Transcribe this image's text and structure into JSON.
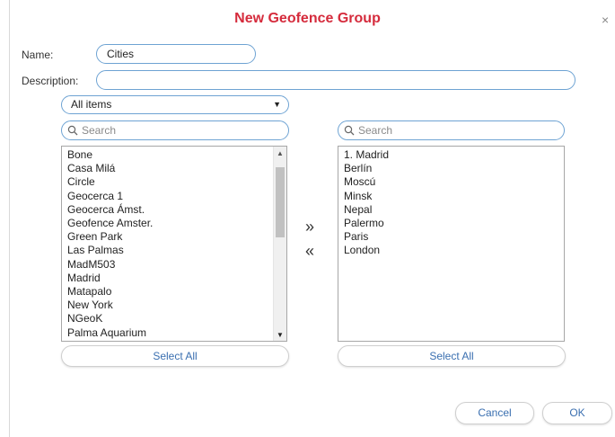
{
  "dialog": {
    "title": "New Geofence Group",
    "close_glyph": "×"
  },
  "form": {
    "name_label": "Name:",
    "name_value": "Cities",
    "description_label": "Description:",
    "description_value": ""
  },
  "filter": {
    "selected": "All items",
    "caret_glyph": "▼"
  },
  "left_list": {
    "search_placeholder": "Search",
    "items": [
      "Bone",
      "Casa Milá",
      "Circle",
      "Geocerca 1",
      "Geocerca Ámst.",
      "Geofence Amster.",
      "Green Park",
      "Las Palmas",
      "MadM503",
      "Madrid",
      "Matapalo",
      "New York",
      "NGeoK",
      "Palma Aquarium"
    ],
    "scroll_position": 0.05,
    "select_all_label": "Select All"
  },
  "right_list": {
    "search_placeholder": "Search",
    "items": [
      "1. Madrid",
      "Berlín",
      "Moscú",
      "Minsk",
      "Nepal",
      "Palermo",
      "Paris",
      "London"
    ],
    "select_all_label": "Select All"
  },
  "transfer": {
    "add_glyph": "»",
    "remove_glyph": "«"
  },
  "footer": {
    "cancel_label": "Cancel",
    "ok_label": "OK"
  },
  "colors": {
    "title": "#d52b3c",
    "input_border": "#6ea3d3",
    "button_text": "#3a6fb0"
  },
  "icons": {
    "search": "search-icon",
    "close": "close-icon",
    "dropdown": "chevron-down-icon",
    "add": "double-chevron-right-icon",
    "remove": "double-chevron-left-icon"
  }
}
